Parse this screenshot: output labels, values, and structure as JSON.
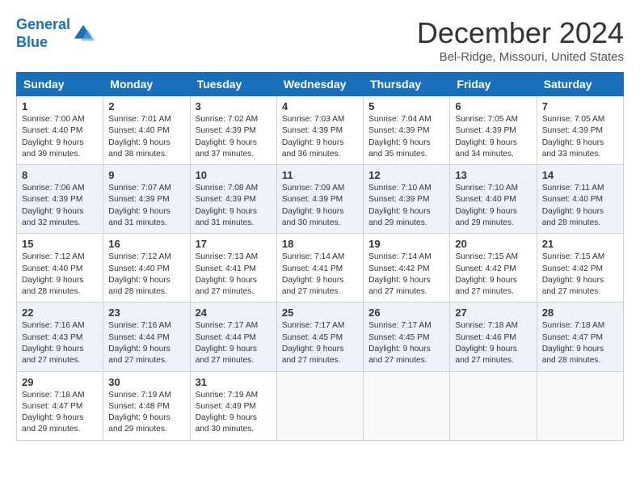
{
  "logo": {
    "line1": "General",
    "line2": "Blue"
  },
  "title": "December 2024",
  "location": "Bel-Ridge, Missouri, United States",
  "days_of_week": [
    "Sunday",
    "Monday",
    "Tuesday",
    "Wednesday",
    "Thursday",
    "Friday",
    "Saturday"
  ],
  "weeks": [
    [
      {
        "day": "1",
        "text": "Sunrise: 7:00 AM\nSunset: 4:40 PM\nDaylight: 9 hours\nand 39 minutes."
      },
      {
        "day": "2",
        "text": "Sunrise: 7:01 AM\nSunset: 4:40 PM\nDaylight: 9 hours\nand 38 minutes."
      },
      {
        "day": "3",
        "text": "Sunrise: 7:02 AM\nSunset: 4:39 PM\nDaylight: 9 hours\nand 37 minutes."
      },
      {
        "day": "4",
        "text": "Sunrise: 7:03 AM\nSunset: 4:39 PM\nDaylight: 9 hours\nand 36 minutes."
      },
      {
        "day": "5",
        "text": "Sunrise: 7:04 AM\nSunset: 4:39 PM\nDaylight: 9 hours\nand 35 minutes."
      },
      {
        "day": "6",
        "text": "Sunrise: 7:05 AM\nSunset: 4:39 PM\nDaylight: 9 hours\nand 34 minutes."
      },
      {
        "day": "7",
        "text": "Sunrise: 7:05 AM\nSunset: 4:39 PM\nDaylight: 9 hours\nand 33 minutes."
      }
    ],
    [
      {
        "day": "8",
        "text": "Sunrise: 7:06 AM\nSunset: 4:39 PM\nDaylight: 9 hours\nand 32 minutes."
      },
      {
        "day": "9",
        "text": "Sunrise: 7:07 AM\nSunset: 4:39 PM\nDaylight: 9 hours\nand 31 minutes."
      },
      {
        "day": "10",
        "text": "Sunrise: 7:08 AM\nSunset: 4:39 PM\nDaylight: 9 hours\nand 31 minutes."
      },
      {
        "day": "11",
        "text": "Sunrise: 7:09 AM\nSunset: 4:39 PM\nDaylight: 9 hours\nand 30 minutes."
      },
      {
        "day": "12",
        "text": "Sunrise: 7:10 AM\nSunset: 4:39 PM\nDaylight: 9 hours\nand 29 minutes."
      },
      {
        "day": "13",
        "text": "Sunrise: 7:10 AM\nSunset: 4:40 PM\nDaylight: 9 hours\nand 29 minutes."
      },
      {
        "day": "14",
        "text": "Sunrise: 7:11 AM\nSunset: 4:40 PM\nDaylight: 9 hours\nand 28 minutes."
      }
    ],
    [
      {
        "day": "15",
        "text": "Sunrise: 7:12 AM\nSunset: 4:40 PM\nDaylight: 9 hours\nand 28 minutes."
      },
      {
        "day": "16",
        "text": "Sunrise: 7:12 AM\nSunset: 4:40 PM\nDaylight: 9 hours\nand 28 minutes."
      },
      {
        "day": "17",
        "text": "Sunrise: 7:13 AM\nSunset: 4:41 PM\nDaylight: 9 hours\nand 27 minutes."
      },
      {
        "day": "18",
        "text": "Sunrise: 7:14 AM\nSunset: 4:41 PM\nDaylight: 9 hours\nand 27 minutes."
      },
      {
        "day": "19",
        "text": "Sunrise: 7:14 AM\nSunset: 4:42 PM\nDaylight: 9 hours\nand 27 minutes."
      },
      {
        "day": "20",
        "text": "Sunrise: 7:15 AM\nSunset: 4:42 PM\nDaylight: 9 hours\nand 27 minutes."
      },
      {
        "day": "21",
        "text": "Sunrise: 7:15 AM\nSunset: 4:42 PM\nDaylight: 9 hours\nand 27 minutes."
      }
    ],
    [
      {
        "day": "22",
        "text": "Sunrise: 7:16 AM\nSunset: 4:43 PM\nDaylight: 9 hours\nand 27 minutes."
      },
      {
        "day": "23",
        "text": "Sunrise: 7:16 AM\nSunset: 4:44 PM\nDaylight: 9 hours\nand 27 minutes."
      },
      {
        "day": "24",
        "text": "Sunrise: 7:17 AM\nSunset: 4:44 PM\nDaylight: 9 hours\nand 27 minutes."
      },
      {
        "day": "25",
        "text": "Sunrise: 7:17 AM\nSunset: 4:45 PM\nDaylight: 9 hours\nand 27 minutes."
      },
      {
        "day": "26",
        "text": "Sunrise: 7:17 AM\nSunset: 4:45 PM\nDaylight: 9 hours\nand 27 minutes."
      },
      {
        "day": "27",
        "text": "Sunrise: 7:18 AM\nSunset: 4:46 PM\nDaylight: 9 hours\nand 27 minutes."
      },
      {
        "day": "28",
        "text": "Sunrise: 7:18 AM\nSunset: 4:47 PM\nDaylight: 9 hours\nand 28 minutes."
      }
    ],
    [
      {
        "day": "29",
        "text": "Sunrise: 7:18 AM\nSunset: 4:47 PM\nDaylight: 9 hours\nand 29 minutes."
      },
      {
        "day": "30",
        "text": "Sunrise: 7:19 AM\nSunset: 4:48 PM\nDaylight: 9 hours\nand 29 minutes."
      },
      {
        "day": "31",
        "text": "Sunrise: 7:19 AM\nSunset: 4:49 PM\nDaylight: 9 hours\nand 30 minutes."
      },
      {
        "day": "",
        "text": ""
      },
      {
        "day": "",
        "text": ""
      },
      {
        "day": "",
        "text": ""
      },
      {
        "day": "",
        "text": ""
      }
    ]
  ]
}
